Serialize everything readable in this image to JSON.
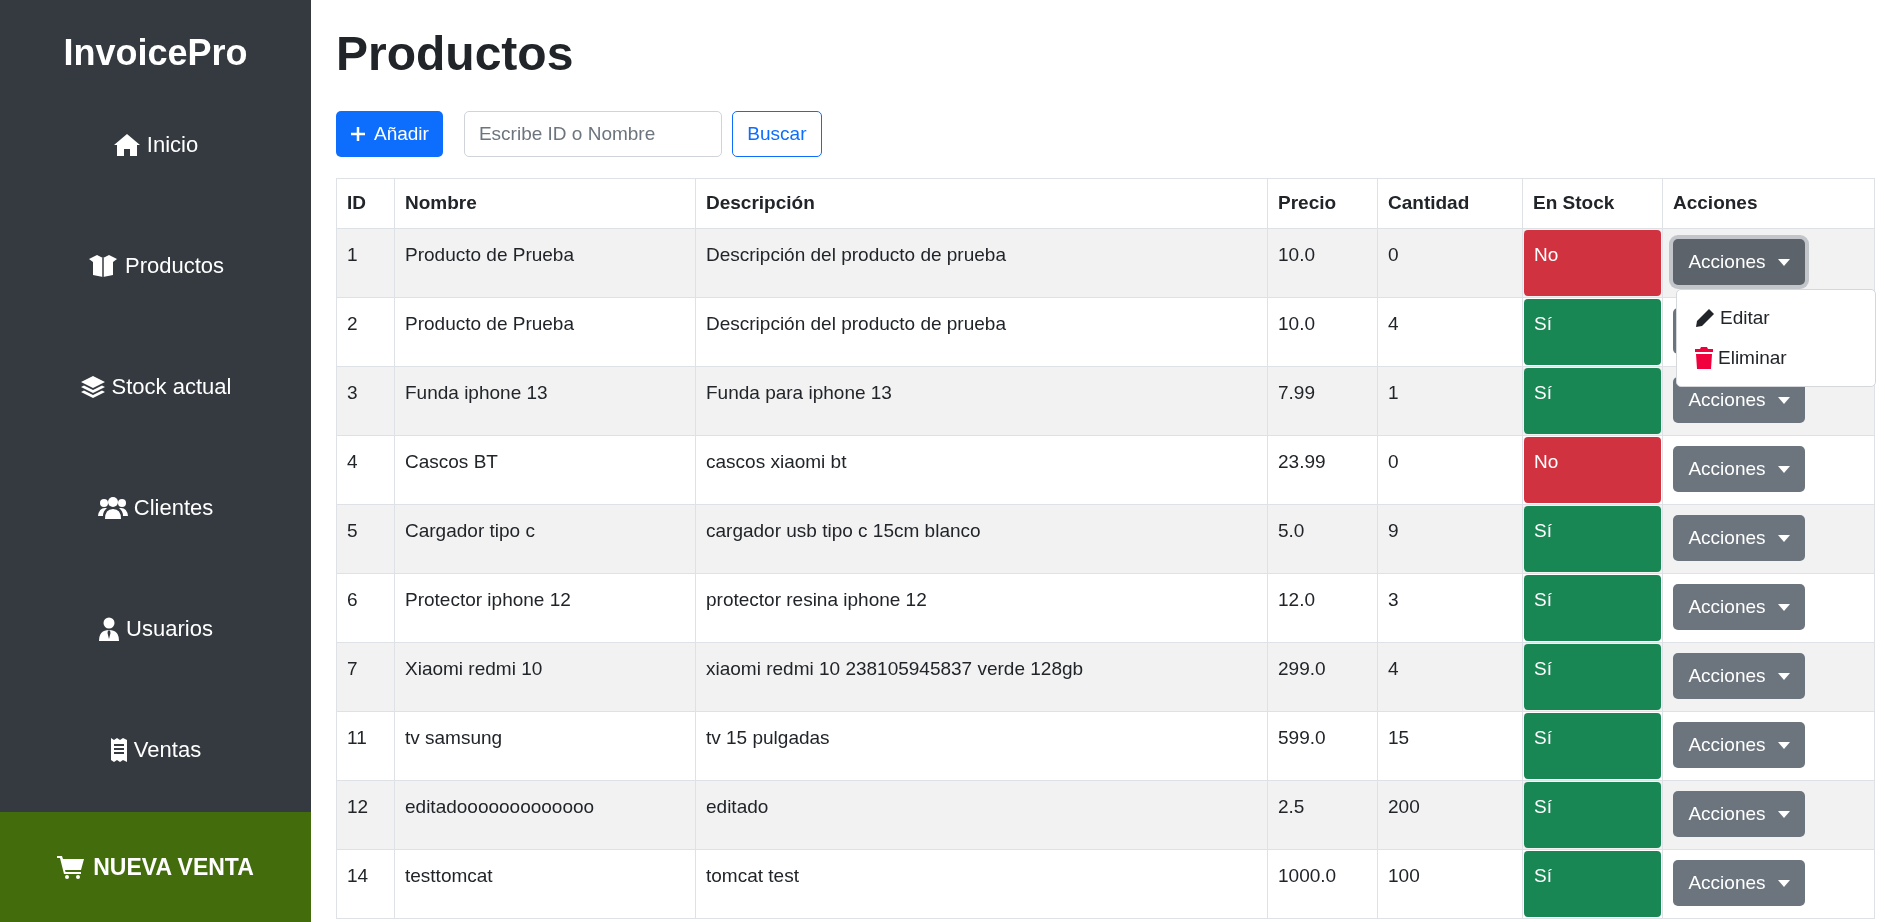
{
  "sidebar": {
    "brand": "InvoicePro",
    "items": [
      {
        "label": "Inicio"
      },
      {
        "label": "Productos"
      },
      {
        "label": "Stock actual"
      },
      {
        "label": "Clientes"
      },
      {
        "label": "Usuarios"
      },
      {
        "label": "Ventas"
      }
    ],
    "cta": {
      "label": "NUEVA VENTA"
    }
  },
  "page_title": "Productos",
  "toolbar": {
    "add_button": "Añadir",
    "search": {
      "placeholder": "Escribe ID o Nombre"
    },
    "search_button": "Buscar"
  },
  "table": {
    "columns": [
      "ID",
      "Nombre",
      "Descripción",
      "Precio",
      "Cantidad",
      "En Stock",
      "Acciones"
    ],
    "rows": [
      {
        "id": "1",
        "name": "Producto de Prueba",
        "description": "Descripción del producto de prueba",
        "price": "10.0",
        "quantity": "0",
        "in_stock": false,
        "stock_label": "No",
        "actions_label": "Acciones",
        "menu_open": true
      },
      {
        "id": "2",
        "name": "Producto de Prueba",
        "description": "Descripción del producto de prueba",
        "price": "10.0",
        "quantity": "4",
        "in_stock": true,
        "stock_label": "Sí",
        "menu_open": false
      },
      {
        "id": "3",
        "name": "Funda iphone 13",
        "description": "Funda para iphone 13",
        "price": "7.99",
        "quantity": "1",
        "in_stock": true,
        "stock_label": "Sí",
        "actions_label": "Acciones",
        "menu_open": false
      },
      {
        "id": "4",
        "name": "Cascos BT",
        "description": "cascos xiaomi bt",
        "price": "23.99",
        "quantity": "0",
        "in_stock": false,
        "stock_label": "No",
        "actions_label": "Acciones",
        "menu_open": false
      },
      {
        "id": "5",
        "name": "Cargador tipo c",
        "description": "cargador usb tipo c 15cm blanco",
        "price": "5.0",
        "quantity": "9",
        "in_stock": true,
        "stock_label": "Sí",
        "actions_label": "Acciones",
        "menu_open": false
      },
      {
        "id": "6",
        "name": "Protector iphone 12",
        "description": "protector resina iphone 12",
        "price": "12.0",
        "quantity": "3",
        "in_stock": true,
        "stock_label": "Sí",
        "actions_label": "Acciones",
        "menu_open": false
      },
      {
        "id": "7",
        "name": "Xiaomi redmi 10",
        "description": "xiaomi redmi 10 238105945837 verde 128gb",
        "price": "299.0",
        "quantity": "4",
        "in_stock": true,
        "stock_label": "Sí",
        "actions_label": "Acciones",
        "menu_open": false
      },
      {
        "id": "11",
        "name": "tv samsung",
        "description": "tv 15 pulgadas",
        "price": "599.0",
        "quantity": "15",
        "in_stock": true,
        "stock_label": "Sí",
        "actions_label": "Acciones",
        "menu_open": false
      },
      {
        "id": "12",
        "name": "editadooooooooooooo",
        "description": "editado",
        "price": "2.5",
        "quantity": "200",
        "in_stock": true,
        "stock_label": "Sí",
        "actions_label": "Acciones",
        "menu_open": false
      },
      {
        "id": "14",
        "name": "testtomcat",
        "description": "tomcat test",
        "price": "1000.0",
        "quantity": "100",
        "in_stock": true,
        "stock_label": "Sí",
        "actions_label": "Acciones",
        "menu_open": false
      }
    ]
  },
  "actions_menu": [
    {
      "label": "Editar",
      "kind": "edit"
    },
    {
      "label": "Eliminar",
      "kind": "delete"
    }
  ]
}
